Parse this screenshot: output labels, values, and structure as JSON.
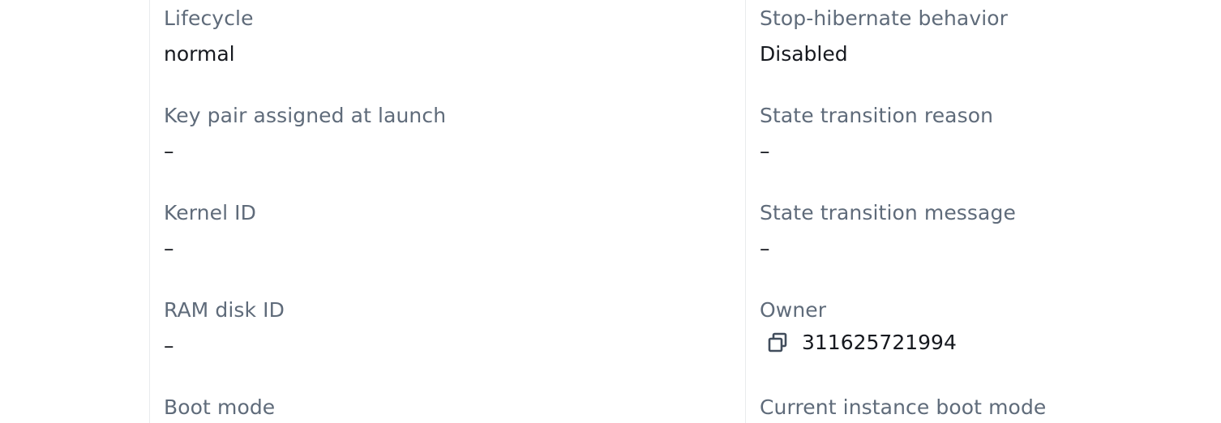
{
  "details": {
    "left": [
      {
        "label": "Lifecycle",
        "value": "normal"
      },
      {
        "label": "Key pair assigned at launch",
        "value": "–"
      },
      {
        "label": "Kernel ID",
        "value": "–"
      },
      {
        "label": "RAM disk ID",
        "value": "–"
      },
      {
        "label": "Boot mode",
        "value": ""
      }
    ],
    "right": [
      {
        "label": "Stop-hibernate behavior",
        "value": "Disabled"
      },
      {
        "label": "State transition reason",
        "value": "–"
      },
      {
        "label": "State transition message",
        "value": "–"
      },
      {
        "label": "Owner",
        "value": "311625721994",
        "icon": "copy-icon"
      },
      {
        "label": "Current instance boot mode",
        "value": ""
      }
    ]
  },
  "colors": {
    "label": "#5f6b7a",
    "value": "#16191f",
    "divider": "#e9ebed"
  }
}
